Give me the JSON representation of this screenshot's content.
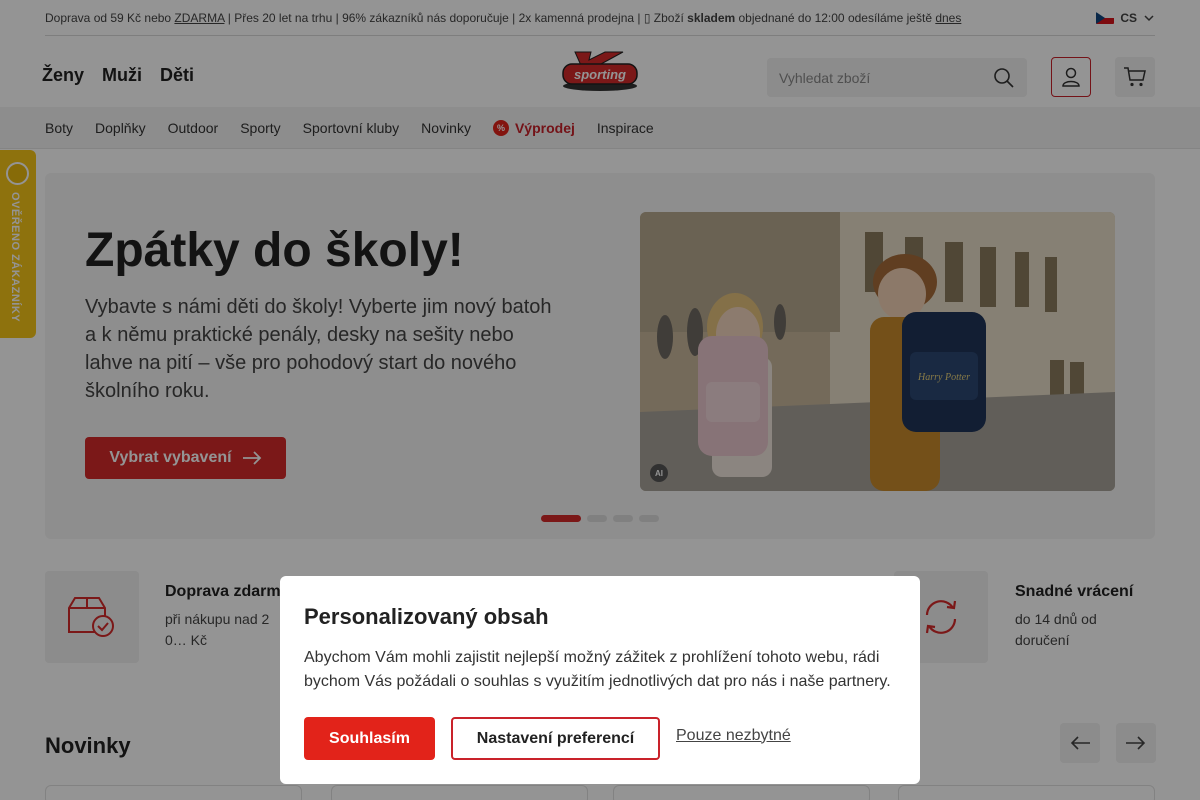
{
  "topbar": {
    "part1": "Doprava od 59 Kč nebo ",
    "zdarma": "ZDARMA",
    "part2": " | Přes 20 let na trhu | 96% zákazníků nás doporučuje | 2x kamenná prodejna | ",
    "part3": "Zboží ",
    "skladem": "skladem",
    "part4": " objednané do 12:00 odesíláme ještě ",
    "dnes": "dnes",
    "lang": "CS"
  },
  "header": {
    "gender": [
      "Ženy",
      "Muži",
      "Děti"
    ],
    "logo_text": "sporting",
    "logo_letter": "K",
    "search_placeholder": "Vyhledat zboží"
  },
  "nav": {
    "items": [
      "Boty",
      "Doplňky",
      "Outdoor",
      "Sporty",
      "Sportovní kluby",
      "Novinky"
    ],
    "sale_icon": "%",
    "sale": "Výprodej",
    "after": "Inspirace"
  },
  "verified_badge": "OVĚŘENO ZÁKAZNÍKY",
  "hero": {
    "title": "Zpátky do školy!",
    "text": "Vybavte s námi děti do školy! Vyberte jim nový batoh a k němu praktické penály, desky na sešity nebo lahve na pití – vše pro pohodový start do nového školního roku.",
    "cta": "Vybrat vybavení",
    "ai_badge": "AI",
    "backpack_label": "Harry Potter",
    "slides": 4,
    "active_slide": 1
  },
  "benefits": [
    {
      "title": "Doprava zdarma",
      "subtitle": "při nákupu nad 2 0… Kč",
      "icon": "box-check-icon"
    },
    {
      "title": "Snadné vrácení",
      "subtitle": "do 14 dnů od doručení",
      "icon": "refresh-icon"
    }
  ],
  "novinky": {
    "title": "Novinky"
  },
  "modal": {
    "title": "Personalizovaný obsah",
    "text": "Abychom Vám mohli zajistit nejlepší možný zážitek z prohlížení tohoto webu, rádi bychom Vás požádali o souhlas s využitím jednotlivých dat pro nás i naše partnery.",
    "accept": "Souhlasím",
    "preferences": "Nastavení preferencí",
    "necessary": "Pouze nezbytné"
  },
  "colors": {
    "brand_red": "#d42a2a",
    "accent_red": "#e2231a",
    "verified_yellow": "#f5c518"
  }
}
